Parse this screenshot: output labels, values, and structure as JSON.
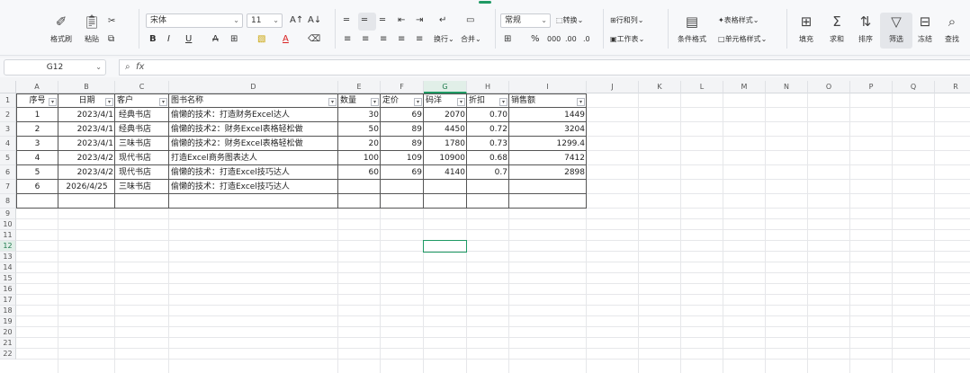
{
  "ribbon": {
    "clipboard": {
      "format_painter": "格式刷",
      "paste": "粘贴",
      "cut_icon": "scissors-icon"
    },
    "font": {
      "name": "宋体",
      "size": "11",
      "bold": "B",
      "italic": "I",
      "underline": "U",
      "strike": "A"
    },
    "alignment": {
      "wrap": "换行",
      "merge": "合并"
    },
    "number": {
      "format": "常规",
      "convert": "转换",
      "percent": "%"
    },
    "cells": {
      "row_col": "行和列",
      "worksheet": "工作表"
    },
    "styles": {
      "conditional": "条件格式",
      "table_style": "表格样式",
      "cell_style": "单元格样式"
    },
    "editing": {
      "fill": "填充",
      "sum": "求和",
      "sort": "排序",
      "filter": "筛选",
      "freeze": "冻结",
      "find": "查找"
    }
  },
  "namebox": {
    "value": "G12",
    "fx": "fx"
  },
  "columns": [
    "A",
    "B",
    "C",
    "D",
    "E",
    "F",
    "G",
    "H",
    "I",
    "J",
    "K",
    "L",
    "M",
    "N",
    "O",
    "P",
    "Q",
    "R"
  ],
  "rows": [
    "1",
    "2",
    "3",
    "4",
    "5",
    "6",
    "7",
    "8",
    "9",
    "10",
    "11",
    "12",
    "13",
    "14",
    "15",
    "16",
    "17",
    "18",
    "19",
    "20",
    "21",
    "22"
  ],
  "table": {
    "headers": [
      "序号",
      "日期",
      "客户",
      "图书名称",
      "数量",
      "定价",
      "码洋",
      "折扣",
      "销售额"
    ],
    "data": [
      [
        "1",
        "2023/4/1",
        "经典书店",
        "偷懒的技术：打造财务Excel达人",
        "30",
        "69",
        "2070",
        "0.70",
        "1449"
      ],
      [
        "2",
        "2023/4/1",
        "经典书店",
        "偷懒的技术2：财务Excel表格轻松做",
        "50",
        "89",
        "4450",
        "0.72",
        "3204"
      ],
      [
        "3",
        "2023/4/1",
        "三味书店",
        "偷懒的技术2：财务Excel表格轻松做",
        "20",
        "89",
        "1780",
        "0.73",
        "1299.4"
      ],
      [
        "4",
        "2023/4/2",
        "现代书店",
        "打造Excel商务图表达人",
        "100",
        "109",
        "10900",
        "0.68",
        "7412"
      ],
      [
        "5",
        "2023/4/2",
        "现代书店",
        "偷懒的技术：打造Excel技巧达人",
        "60",
        "69",
        "4140",
        "0.7",
        "2898"
      ],
      [
        "6",
        "2026/4/25",
        "三味书店",
        "偷懒的技术：打造Excel技巧达人",
        "",
        "",
        "",
        "",
        ""
      ]
    ]
  },
  "selection": {
    "cell": "G12",
    "column": "G",
    "row": "12"
  },
  "colors": {
    "accent": "#1f9a64"
  }
}
